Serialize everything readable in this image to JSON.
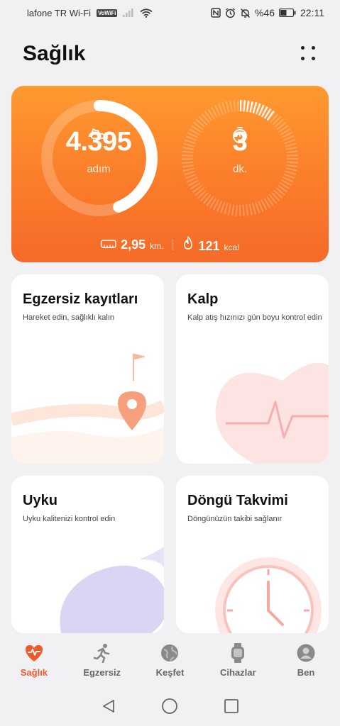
{
  "status_bar": {
    "carrier": "lafone TR Wi-Fi",
    "vowifi_badge": "VoWiFi",
    "battery": "%46",
    "time": "22:11"
  },
  "header": {
    "title": "Sağlık"
  },
  "activity": {
    "steps_value": "4.395",
    "steps_unit": "adım",
    "steps_progress": 0.44,
    "minutes_value": "3",
    "minutes_unit": "dk.",
    "minutes_progress": 0.1,
    "distance_value": "2,95",
    "distance_unit": "km.",
    "calories_value": "121",
    "calories_unit": "kcal"
  },
  "tiles": [
    {
      "title": "Egzersiz kayıtları",
      "subtitle": "Hareket edin, sağlıklı kalın"
    },
    {
      "title": "Kalp",
      "subtitle": "Kalp atış hızınızı gün boyu kontrol edin"
    },
    {
      "title": "Uyku",
      "subtitle": "Uyku kalitenizi kontrol edin"
    },
    {
      "title": "Döngü Takvimi",
      "subtitle": "Döngünüzün takibi sağlanır"
    }
  ],
  "bottom_nav": [
    {
      "label": "Sağlık",
      "icon": "heart-pulse-icon",
      "active": true
    },
    {
      "label": "Egzersiz",
      "icon": "running-icon",
      "active": false
    },
    {
      "label": "Keşfet",
      "icon": "globe-icon",
      "active": false
    },
    {
      "label": "Cihazlar",
      "icon": "watch-icon",
      "active": false
    },
    {
      "label": "Ben",
      "icon": "person-icon",
      "active": false
    }
  ],
  "colors": {
    "accent": "#f05a28",
    "card_gradient_top": "#ff9a30",
    "card_gradient_bottom": "#f56a28"
  }
}
